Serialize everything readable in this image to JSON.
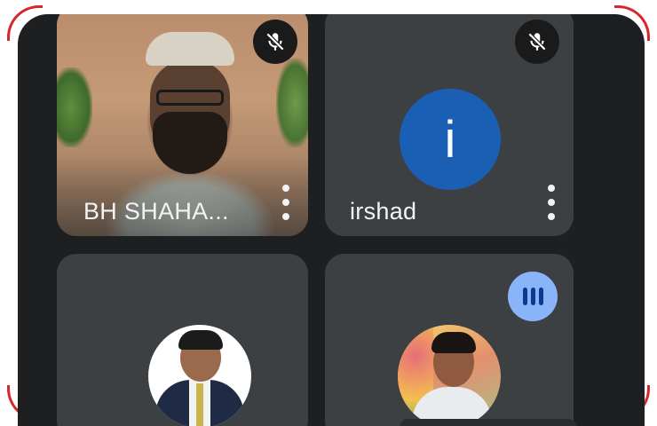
{
  "participants": [
    {
      "name": "BH SHAHA...",
      "muted": true,
      "has_video": true
    },
    {
      "name": "irshad",
      "muted": true,
      "avatar_letter": "i",
      "avatar_color": "#1a5fb4"
    },
    {
      "name": "",
      "muted": false,
      "has_photo": true
    },
    {
      "name": "",
      "muted": false,
      "has_photo": true,
      "speaking": true
    }
  ],
  "icons": {
    "mute": "mic-off-icon",
    "more": "more-vert-icon",
    "speaking": "audio-level-icon"
  },
  "colors": {
    "background": "#1e1f21",
    "tile": "#3c4043",
    "frame_accent": "#d8262a",
    "speaking_indicator": "#8ab4f8"
  }
}
